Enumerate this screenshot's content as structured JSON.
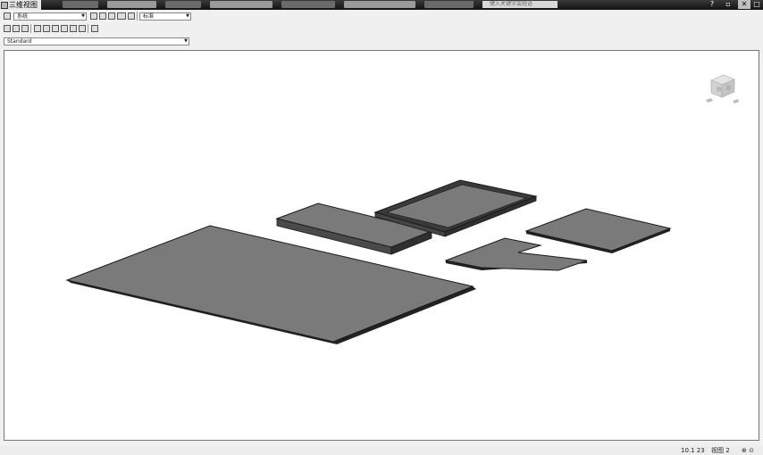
{
  "window": {
    "title": "三维视图"
  },
  "toolbar1": {
    "combo1": {
      "value": "系统"
    },
    "combo2": {
      "value": "标准"
    }
  },
  "toolbar3": {
    "style_combo": {
      "value": "Standard"
    }
  },
  "search": {
    "placeholder": "键入关键字或短语"
  },
  "status": {
    "coords": "10.1  23",
    "scale": "视图 2",
    "zoom": "⊕ ⊙"
  },
  "colors": {
    "slab_top": "#7a7a7a",
    "slab_side": "#3a3a3a",
    "slab_edge": "#1a1a1a",
    "background": "#ffffff"
  },
  "icons": {
    "close": "close-icon",
    "minimize": "minimize-icon",
    "help": "help-icon"
  }
}
